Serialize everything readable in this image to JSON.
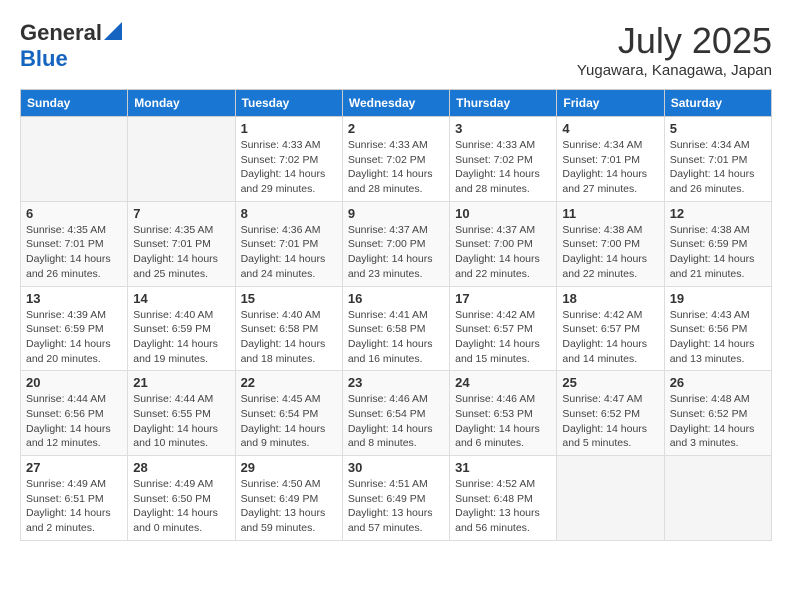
{
  "logo": {
    "general": "General",
    "blue": "Blue"
  },
  "title": "July 2025",
  "location": "Yugawara, Kanagawa, Japan",
  "days_of_week": [
    "Sunday",
    "Monday",
    "Tuesday",
    "Wednesday",
    "Thursday",
    "Friday",
    "Saturday"
  ],
  "weeks": [
    [
      {
        "day": "",
        "info": ""
      },
      {
        "day": "",
        "info": ""
      },
      {
        "day": "1",
        "sunrise": "Sunrise: 4:33 AM",
        "sunset": "Sunset: 7:02 PM",
        "daylight": "Daylight: 14 hours and 29 minutes."
      },
      {
        "day": "2",
        "sunrise": "Sunrise: 4:33 AM",
        "sunset": "Sunset: 7:02 PM",
        "daylight": "Daylight: 14 hours and 28 minutes."
      },
      {
        "day": "3",
        "sunrise": "Sunrise: 4:33 AM",
        "sunset": "Sunset: 7:02 PM",
        "daylight": "Daylight: 14 hours and 28 minutes."
      },
      {
        "day": "4",
        "sunrise": "Sunrise: 4:34 AM",
        "sunset": "Sunset: 7:01 PM",
        "daylight": "Daylight: 14 hours and 27 minutes."
      },
      {
        "day": "5",
        "sunrise": "Sunrise: 4:34 AM",
        "sunset": "Sunset: 7:01 PM",
        "daylight": "Daylight: 14 hours and 26 minutes."
      }
    ],
    [
      {
        "day": "6",
        "sunrise": "Sunrise: 4:35 AM",
        "sunset": "Sunset: 7:01 PM",
        "daylight": "Daylight: 14 hours and 26 minutes."
      },
      {
        "day": "7",
        "sunrise": "Sunrise: 4:35 AM",
        "sunset": "Sunset: 7:01 PM",
        "daylight": "Daylight: 14 hours and 25 minutes."
      },
      {
        "day": "8",
        "sunrise": "Sunrise: 4:36 AM",
        "sunset": "Sunset: 7:01 PM",
        "daylight": "Daylight: 14 hours and 24 minutes."
      },
      {
        "day": "9",
        "sunrise": "Sunrise: 4:37 AM",
        "sunset": "Sunset: 7:00 PM",
        "daylight": "Daylight: 14 hours and 23 minutes."
      },
      {
        "day": "10",
        "sunrise": "Sunrise: 4:37 AM",
        "sunset": "Sunset: 7:00 PM",
        "daylight": "Daylight: 14 hours and 22 minutes."
      },
      {
        "day": "11",
        "sunrise": "Sunrise: 4:38 AM",
        "sunset": "Sunset: 7:00 PM",
        "daylight": "Daylight: 14 hours and 22 minutes."
      },
      {
        "day": "12",
        "sunrise": "Sunrise: 4:38 AM",
        "sunset": "Sunset: 6:59 PM",
        "daylight": "Daylight: 14 hours and 21 minutes."
      }
    ],
    [
      {
        "day": "13",
        "sunrise": "Sunrise: 4:39 AM",
        "sunset": "Sunset: 6:59 PM",
        "daylight": "Daylight: 14 hours and 20 minutes."
      },
      {
        "day": "14",
        "sunrise": "Sunrise: 4:40 AM",
        "sunset": "Sunset: 6:59 PM",
        "daylight": "Daylight: 14 hours and 19 minutes."
      },
      {
        "day": "15",
        "sunrise": "Sunrise: 4:40 AM",
        "sunset": "Sunset: 6:58 PM",
        "daylight": "Daylight: 14 hours and 18 minutes."
      },
      {
        "day": "16",
        "sunrise": "Sunrise: 4:41 AM",
        "sunset": "Sunset: 6:58 PM",
        "daylight": "Daylight: 14 hours and 16 minutes."
      },
      {
        "day": "17",
        "sunrise": "Sunrise: 4:42 AM",
        "sunset": "Sunset: 6:57 PM",
        "daylight": "Daylight: 14 hours and 15 minutes."
      },
      {
        "day": "18",
        "sunrise": "Sunrise: 4:42 AM",
        "sunset": "Sunset: 6:57 PM",
        "daylight": "Daylight: 14 hours and 14 minutes."
      },
      {
        "day": "19",
        "sunrise": "Sunrise: 4:43 AM",
        "sunset": "Sunset: 6:56 PM",
        "daylight": "Daylight: 14 hours and 13 minutes."
      }
    ],
    [
      {
        "day": "20",
        "sunrise": "Sunrise: 4:44 AM",
        "sunset": "Sunset: 6:56 PM",
        "daylight": "Daylight: 14 hours and 12 minutes."
      },
      {
        "day": "21",
        "sunrise": "Sunrise: 4:44 AM",
        "sunset": "Sunset: 6:55 PM",
        "daylight": "Daylight: 14 hours and 10 minutes."
      },
      {
        "day": "22",
        "sunrise": "Sunrise: 4:45 AM",
        "sunset": "Sunset: 6:54 PM",
        "daylight": "Daylight: 14 hours and 9 minutes."
      },
      {
        "day": "23",
        "sunrise": "Sunrise: 4:46 AM",
        "sunset": "Sunset: 6:54 PM",
        "daylight": "Daylight: 14 hours and 8 minutes."
      },
      {
        "day": "24",
        "sunrise": "Sunrise: 4:46 AM",
        "sunset": "Sunset: 6:53 PM",
        "daylight": "Daylight: 14 hours and 6 minutes."
      },
      {
        "day": "25",
        "sunrise": "Sunrise: 4:47 AM",
        "sunset": "Sunset: 6:52 PM",
        "daylight": "Daylight: 14 hours and 5 minutes."
      },
      {
        "day": "26",
        "sunrise": "Sunrise: 4:48 AM",
        "sunset": "Sunset: 6:52 PM",
        "daylight": "Daylight: 14 hours and 3 minutes."
      }
    ],
    [
      {
        "day": "27",
        "sunrise": "Sunrise: 4:49 AM",
        "sunset": "Sunset: 6:51 PM",
        "daylight": "Daylight: 14 hours and 2 minutes."
      },
      {
        "day": "28",
        "sunrise": "Sunrise: 4:49 AM",
        "sunset": "Sunset: 6:50 PM",
        "daylight": "Daylight: 14 hours and 0 minutes."
      },
      {
        "day": "29",
        "sunrise": "Sunrise: 4:50 AM",
        "sunset": "Sunset: 6:49 PM",
        "daylight": "Daylight: 13 hours and 59 minutes."
      },
      {
        "day": "30",
        "sunrise": "Sunrise: 4:51 AM",
        "sunset": "Sunset: 6:49 PM",
        "daylight": "Daylight: 13 hours and 57 minutes."
      },
      {
        "day": "31",
        "sunrise": "Sunrise: 4:52 AM",
        "sunset": "Sunset: 6:48 PM",
        "daylight": "Daylight: 13 hours and 56 minutes."
      },
      {
        "day": "",
        "info": ""
      },
      {
        "day": "",
        "info": ""
      }
    ]
  ]
}
